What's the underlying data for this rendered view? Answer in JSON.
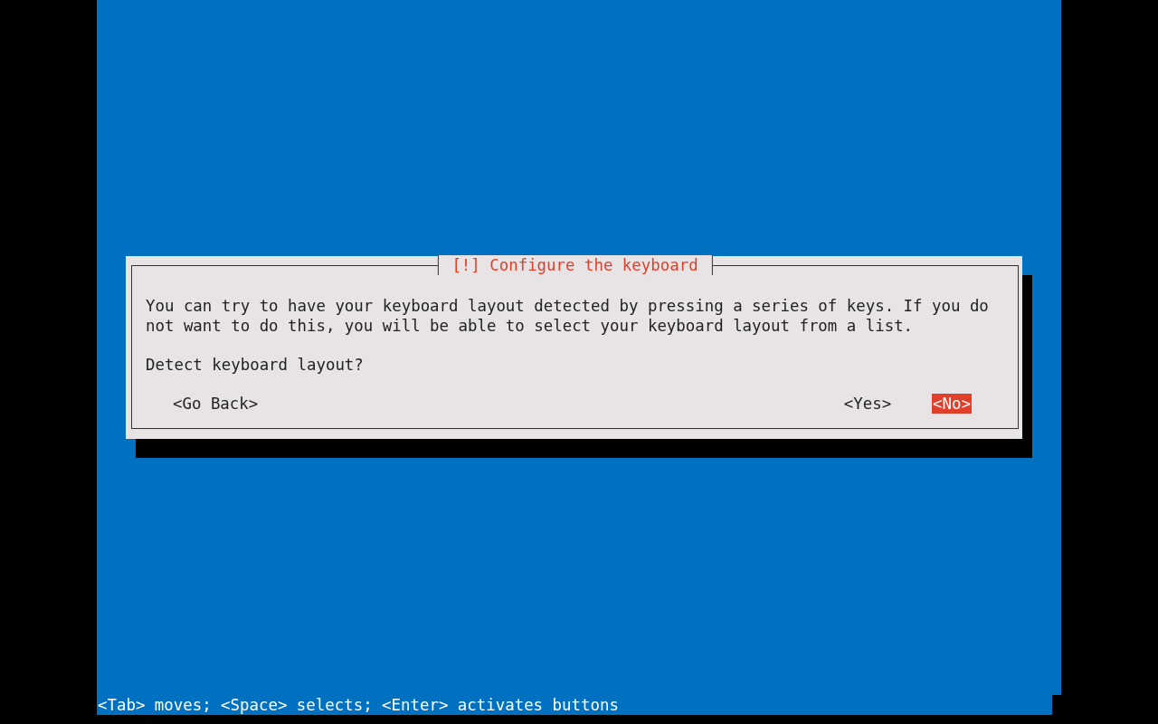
{
  "dialog": {
    "title": "[!] Configure the keyboard",
    "message": "You can try to have your keyboard layout detected by pressing a series of keys. If you do not want to do this, you will be able to select your keyboard layout from a list.",
    "question": "Detect keyboard layout?",
    "buttons": [
      {
        "label": "<Go Back>",
        "selected": false
      },
      {
        "label": "<Yes>",
        "selected": false
      },
      {
        "label": "<No>",
        "selected": true
      }
    ]
  },
  "status_bar": "<Tab> moves; <Space> selects; <Enter> activates buttons"
}
